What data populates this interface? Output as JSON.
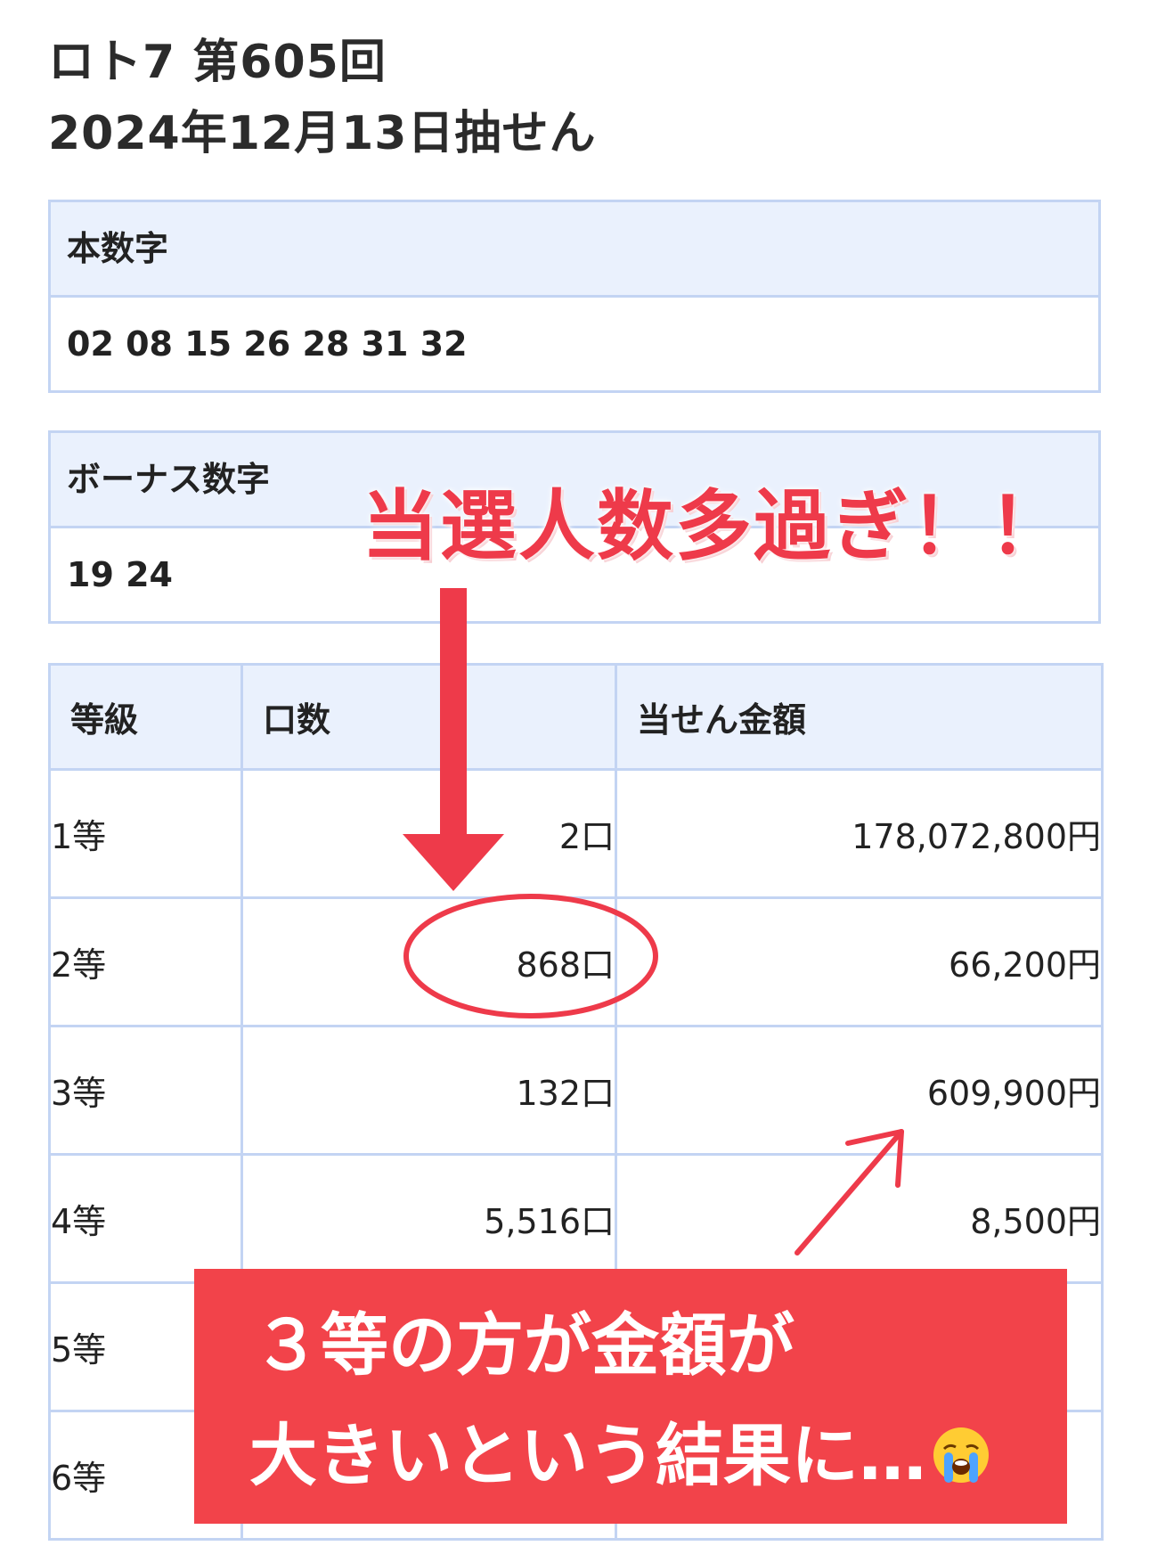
{
  "header": {
    "title_line1": "ロト7 第605回",
    "title_line2": "2024年12月13日抽せん"
  },
  "main_numbers": {
    "label": "本数字",
    "value": "02 08 15 26 28 31 32"
  },
  "bonus_numbers": {
    "label": "ボーナス数字",
    "value": "19 24"
  },
  "prize_table": {
    "columns": [
      "等級",
      "口数",
      "当せん金額"
    ],
    "rows": [
      {
        "grade": "1等",
        "count": "2口",
        "amount": "178,072,800円"
      },
      {
        "grade": "2等",
        "count": "868口",
        "amount": "66,200円"
      },
      {
        "grade": "3等",
        "count": "132口",
        "amount": "609,900円"
      },
      {
        "grade": "4等",
        "count": "5,516口",
        "amount": "8,500円"
      },
      {
        "grade": "5等",
        "count": "",
        "amount": ""
      },
      {
        "grade": "6等",
        "count": "",
        "amount": ""
      }
    ]
  },
  "annotations": {
    "headline": "当選人数多過ぎ！！",
    "note_line1": "３等の方が金額が",
    "note_line2": "大きいという結果に…",
    "note_emoji": "crying-face-emoji",
    "accent_color": "#ee3a4a",
    "note_bg_color": "#f2434a"
  }
}
